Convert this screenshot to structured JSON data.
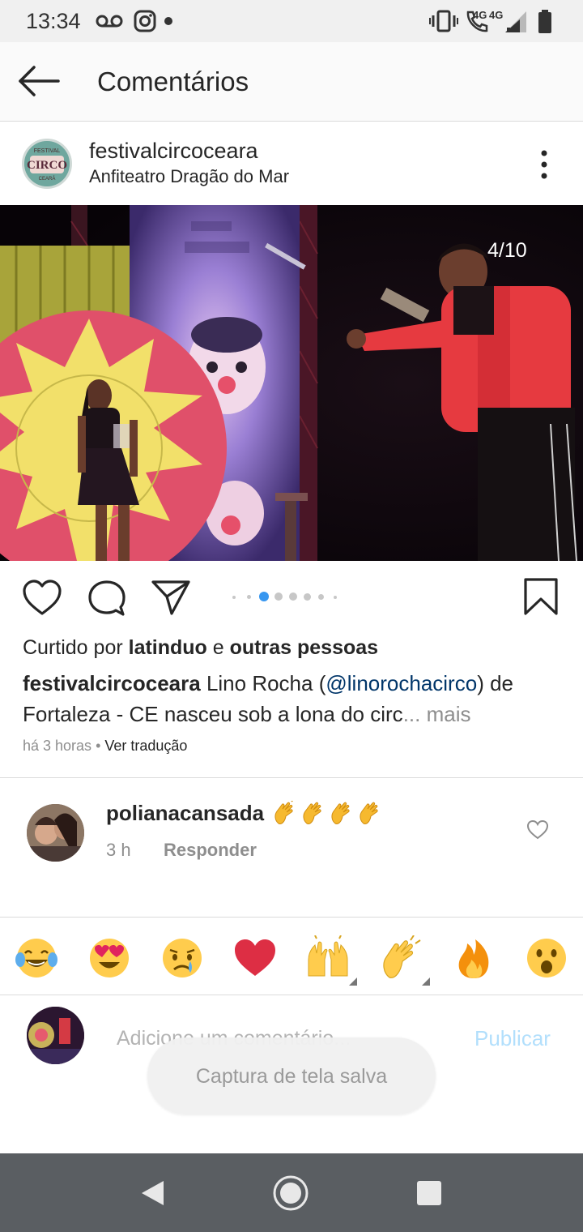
{
  "status_bar": {
    "time": "13:34",
    "network": "4G",
    "icons": [
      "voicemail-icon",
      "instagram-icon",
      "vibrate-icon",
      "volte-call-icon",
      "signal-icon",
      "battery-icon"
    ]
  },
  "app_bar": {
    "title": "Comentários"
  },
  "post": {
    "username": "festivalcircoceara",
    "location": "Anfiteatro Dragão do Mar",
    "photo_counter": "4/10",
    "carousel_pages": 6,
    "carousel_active": 1,
    "likes": {
      "prefix": "Curtido por ",
      "user": "latinduo",
      "middle": " e ",
      "others": "outras pessoas"
    },
    "caption": {
      "user": "festivalcircoceara",
      "text_before": " Lino Rocha (",
      "mention": "@linorochacirco",
      "text_after": ") de Fortaleza - CE nasceu sob a lona do circ",
      "more": "... mais"
    },
    "time_ago": "há 3 horas",
    "separator": " • ",
    "translate": "Ver tradução"
  },
  "comments": [
    {
      "username": "polianacansada",
      "emoji": [
        "clapping-hands",
        "clapping-hands",
        "clapping-hands",
        "clapping-hands"
      ],
      "time": "3 h",
      "reply": "Responder"
    }
  ],
  "emoji_bar": [
    "face-with-tears-of-joy",
    "heart-eyes",
    "crying-face",
    "red-heart",
    "raising-hands",
    "clapping-hands",
    "fire",
    "astonished-face"
  ],
  "composer": {
    "placeholder": "Adicione um comentário...",
    "publish": "Publicar"
  },
  "toast": "Captura de tela salva",
  "colors": {
    "link": "#003569",
    "publish_disabled": "#b2dffc",
    "carousel_active": "#3897f0",
    "muted": "#8e8e8e"
  }
}
